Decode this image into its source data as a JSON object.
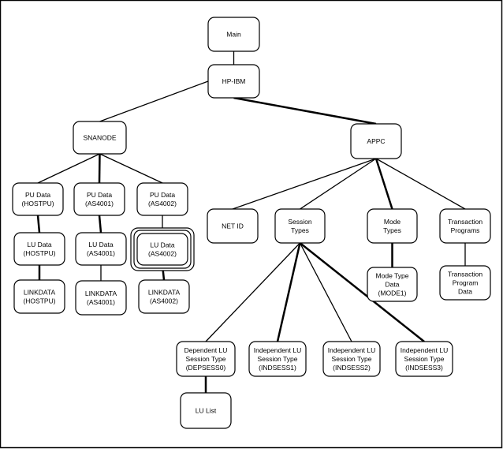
{
  "diagram": {
    "nodes": {
      "main": [
        "Main"
      ],
      "hpibm": [
        "HP-IBM"
      ],
      "snanode": [
        "SNANODE"
      ],
      "appc": [
        "APPC"
      ],
      "pu_hostpu": [
        "PU Data",
        "(HOSTPU)"
      ],
      "pu_as4001": [
        "PU Data",
        "(AS4001)"
      ],
      "pu_as4002": [
        "PU Data",
        "(AS4002)"
      ],
      "lu_hostpu": [
        "LU Data",
        "(HOSTPU)"
      ],
      "lu_as4001": [
        "LU Data",
        "(AS4001)"
      ],
      "lu_as4002": [
        "LU Data",
        "(AS4002)"
      ],
      "link_hostpu": [
        "LINKDATA",
        "(HOSTPU)"
      ],
      "link_as4001": [
        "LINKDATA",
        "(AS4001)"
      ],
      "link_as4002": [
        "LINKDATA",
        "(AS4002)"
      ],
      "netid": [
        "NET ID"
      ],
      "session_types": [
        "Session",
        "Types"
      ],
      "mode_types": [
        "Mode",
        "Types"
      ],
      "tp": [
        "Transaction",
        "Programs"
      ],
      "mode_data": [
        "Mode Type",
        "Data",
        "(MODE1)"
      ],
      "tp_data": [
        "Transaction",
        "Program",
        "Data"
      ],
      "depsess0": [
        "Dependent LU",
        "Session Type",
        "(DEPSESS0)"
      ],
      "indsess1": [
        "Independent LU",
        "Session Type",
        "(INDSESS1)"
      ],
      "indsess2": [
        "Independent LU",
        "Session Type",
        "(INDSESS2)"
      ],
      "indsess3": [
        "Independent LU",
        "Session Type",
        "(INDSESS3)"
      ],
      "lulist": [
        "LU List"
      ]
    },
    "selected_node": "lu_as4002"
  }
}
